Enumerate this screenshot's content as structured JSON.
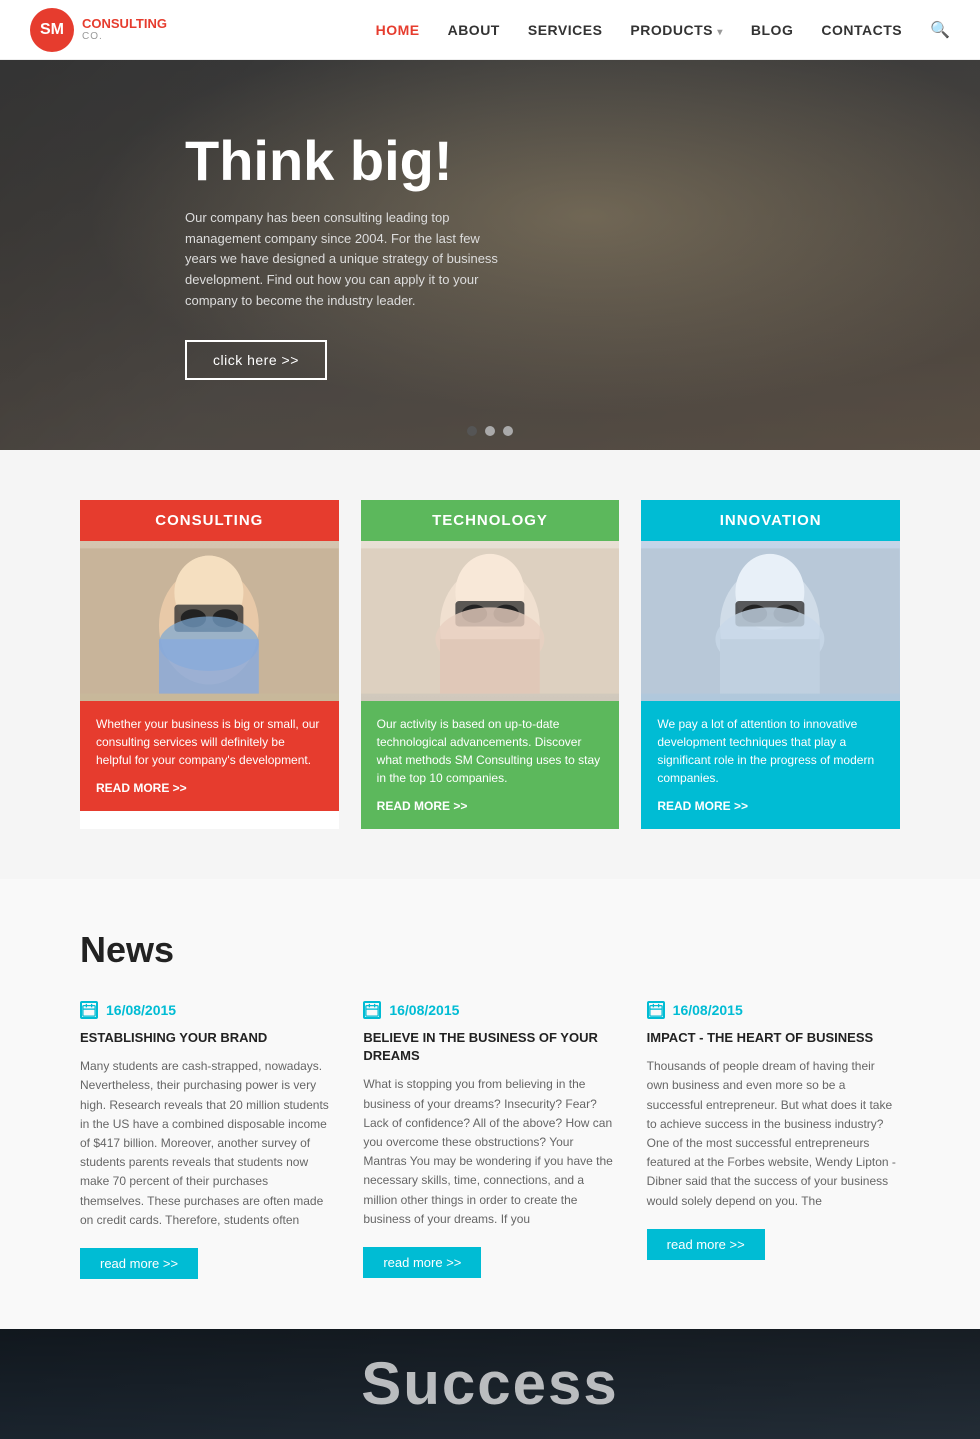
{
  "logo": {
    "badge": "SM",
    "name": "CONSULTING",
    "sub": "CO."
  },
  "nav": {
    "items": [
      {
        "label": "HOME",
        "active": true,
        "has_arrow": true
      },
      {
        "label": "ABOUT",
        "active": false,
        "has_arrow": false
      },
      {
        "label": "SERVICES",
        "active": false,
        "has_arrow": false
      },
      {
        "label": "PRODUCTS",
        "active": false,
        "has_arrow": true
      },
      {
        "label": "BLOG",
        "active": false,
        "has_arrow": false
      },
      {
        "label": "CONTACTS",
        "active": false,
        "has_arrow": false
      }
    ]
  },
  "hero": {
    "title": "Think big!",
    "description": "Our company has been consulting leading top management company since 2004. For the last few years we have designed a unique strategy of business development. Find out how you can apply it to your company to become the industry leader.",
    "button_label": "click here >>",
    "dots": [
      1,
      2,
      3
    ]
  },
  "cards": [
    {
      "id": "consulting",
      "header": "CONSULTING",
      "theme": "red",
      "description": "Whether your business is big or small, our consulting services will definitely be helpful for your company's development.",
      "link": "READ MORE >>"
    },
    {
      "id": "technology",
      "header": "TECHNOLOGY",
      "theme": "green",
      "description": "Our activity is based on up-to-date technological advancements. Discover what methods SM Consulting uses to stay in the top 10 companies.",
      "link": "READ MORE >>"
    },
    {
      "id": "innovation",
      "header": "INNOVATION",
      "theme": "teal",
      "description": "We pay a lot of attention to innovative development techniques that play a significant role in the progress of modern companies.",
      "link": "READ MORE >>"
    }
  ],
  "news": {
    "section_title": "News",
    "items": [
      {
        "date": "16/08/2015",
        "title": "ESTABLISHING YOUR BRAND",
        "text": "Many students are cash-strapped, nowadays. Nevertheless, their purchasing power is very high. Research reveals that 20 million students in the US have a combined disposable income of $417 billion. Moreover, another survey of students parents reveals that students now make 70 percent of their purchases themselves. These purchases are often made on credit cards. Therefore, students often",
        "button": "read more >>"
      },
      {
        "date": "16/08/2015",
        "title": "BELIEVE IN THE BUSINESS OF YOUR DREAMS",
        "text": "What is stopping you from believing in the business of your dreams? Insecurity? Fear? Lack of confidence? All of the above? How can you overcome these obstructions? Your Mantras You may be wondering if you have the necessary skills, time, connections, and a million other things in order to create the business of your dreams. If you",
        "button": "read more >>"
      },
      {
        "date": "16/08/2015",
        "title": "IMPACT - THE HEART OF BUSINESS",
        "text": "Thousands of people dream of having their own business and even more so be a successful entrepreneur. But what does it take to achieve success in the business industry? One of the most successful entrepreneurs featured at the Forbes website, Wendy Lipton - Dibner said that the success of your business would solely depend on you. The",
        "button": "read more >>"
      }
    ]
  },
  "success": {
    "title": "Success"
  }
}
